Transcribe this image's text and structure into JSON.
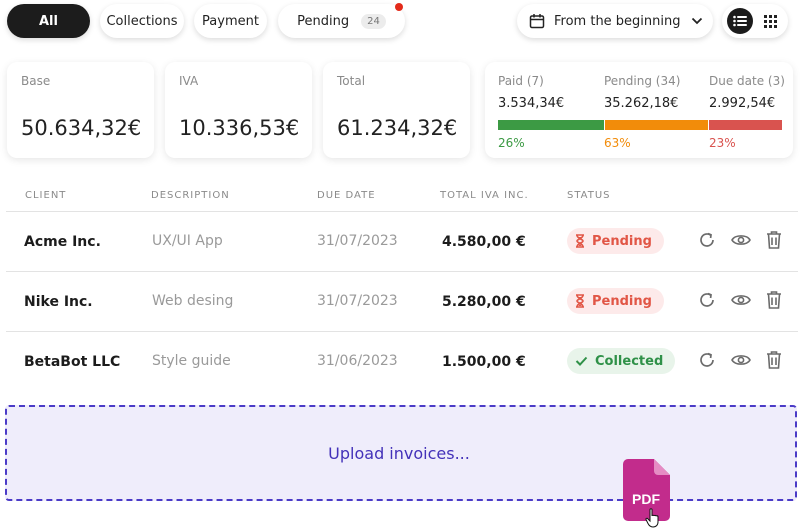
{
  "filters": {
    "all": "All",
    "collections": "Collections",
    "payment": "Payment",
    "pending": "Pending",
    "pending_count": "24",
    "date_range": "From the beginning"
  },
  "summary": {
    "base": {
      "label": "Base",
      "value": "50.634,32€"
    },
    "iva": {
      "label": "IVA",
      "value": "10.336,53€"
    },
    "total": {
      "label": "Total",
      "value": "61.234,32€"
    },
    "status": {
      "paid": {
        "label": "Paid (7)",
        "value": "3.534,34€",
        "pct": "26%",
        "fraction": 0.26,
        "color": "#3c9a44"
      },
      "pending": {
        "label": "Pending (34)",
        "value": "35.262,18€",
        "pct": "63%",
        "fraction": 0.63,
        "color": "#f28c0a"
      },
      "due": {
        "label": "Due date (3)",
        "value": "2.992,54€",
        "pct": "23%",
        "fraction": 0.23,
        "color": "#d9534f"
      }
    }
  },
  "table": {
    "headers": {
      "client": "CLIENT",
      "description": "DESCRIPTION",
      "due_date": "DUE DATE",
      "total": "TOTAL IVA INC.",
      "status": "STATUS"
    },
    "rows": [
      {
        "client": "Acme Inc.",
        "description": "UX/UI App",
        "due_date": "31/07/2023",
        "total": "4.580,00 €",
        "status": "Pending"
      },
      {
        "client": "Nike Inc.",
        "description": "Web desing",
        "due_date": "31/07/2023",
        "total": "5.280,00 €",
        "status": "Pending"
      },
      {
        "client": "BetaBot LLC",
        "description": "Style guide",
        "due_date": "31/06/2023",
        "total": "1.500,00 €",
        "status": "Collected"
      }
    ]
  },
  "upload": {
    "label": "Upload invoices..."
  },
  "drag_file": {
    "label": "PDF"
  },
  "colors": {
    "accent": "#4b3bc7",
    "dark": "#1c1c1c",
    "pdf": "#c22c8c"
  }
}
